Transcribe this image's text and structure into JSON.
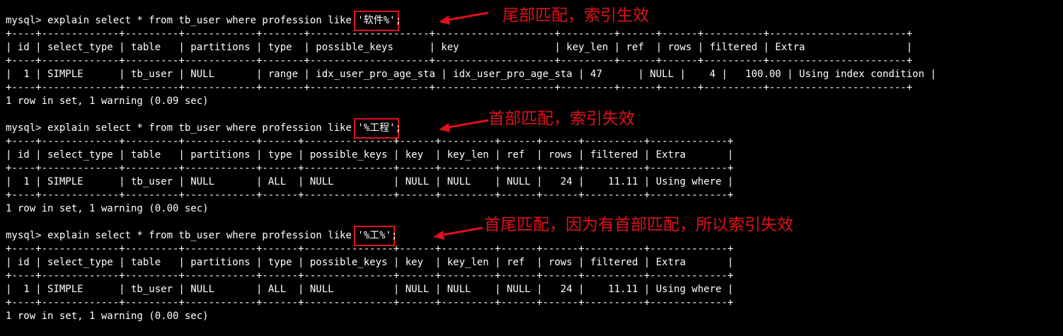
{
  "style": {
    "background": "#000000",
    "text_color": "#ffffff",
    "annotation_color": "#e0101c"
  },
  "queries": [
    {
      "cmd_prefix": "mysql> explain select * from tb_user where profession like ",
      "cmd_literal": "'软件%'",
      "cmd_suffix": ";",
      "border": "+----+-------------+---------+------------+-------+--------------------+--------------------+---------+------+------+----------+-----------------------+",
      "header": "| id | select_type | table   | partitions | type  | possible_keys      | key                | key_len | ref  | rows | filtered | Extra                 |",
      "row": "|  1 | SIMPLE      | tb_user | NULL       | range | idx_user_pro_age_sta | idx_user_pro_age_sta | 47      | NULL |    4 |   100.00 | Using index condition |",
      "summary": "1 row in set, 1 warning (0.09 sec)",
      "note": "尾部匹配，索引生效"
    },
    {
      "cmd_prefix": "mysql> explain select * from tb_user where profession like ",
      "cmd_literal": "'%工程'",
      "cmd_suffix": ";",
      "border": "+----+-------------+---------+------------+------+---------------+------+---------+------+------+----------+-------------+",
      "header": "| id | select_type | table   | partitions | type | possible_keys | key  | key_len | ref  | rows | filtered | Extra       |",
      "row": "|  1 | SIMPLE      | tb_user | NULL       | ALL  | NULL          | NULL | NULL    | NULL |   24 |    11.11 | Using where |",
      "summary": "1 row in set, 1 warning (0.00 sec)",
      "note": "首部匹配，索引失效"
    },
    {
      "cmd_prefix": "mysql> explain select * from tb_user where profession like ",
      "cmd_literal": "'%工%'",
      "cmd_suffix": ";",
      "border": "+----+-------------+---------+------------+------+---------------+------+---------+------+------+----------+-------------+",
      "header": "| id | select_type | table   | partitions | type | possible_keys | key  | key_len | ref  | rows | filtered | Extra       |",
      "row": "|  1 | SIMPLE      | tb_user | NULL       | ALL  | NULL          | NULL | NULL    | NULL |   24 |    11.11 | Using where |",
      "summary": "1 row in set, 1 warning (0.00 sec)",
      "note": "首尾匹配，因为有首部匹配，所以索引失效"
    }
  ]
}
